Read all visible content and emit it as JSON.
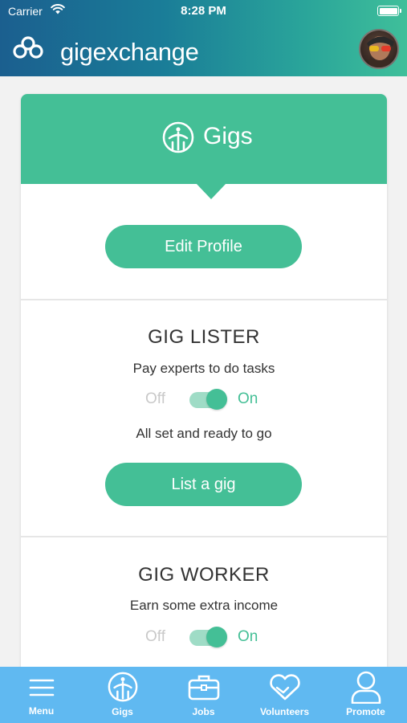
{
  "status_bar": {
    "carrier": "Carrier",
    "time": "8:28 PM"
  },
  "header": {
    "brand": "gigexchange",
    "logo_icon": "infinity-link-icon",
    "avatar_icon": "user-avatar"
  },
  "card": {
    "title": "Gigs",
    "title_icon": "gig-person-icon",
    "edit_profile_label": "Edit Profile",
    "lister": {
      "title": "GIG LISTER",
      "subtitle": "Pay experts to do tasks",
      "toggle_off_label": "Off",
      "toggle_on_label": "On",
      "toggle_state": "on",
      "status": "All set and ready to go",
      "action_label": "List a gig"
    },
    "worker": {
      "title": "GIG WORKER",
      "subtitle": "Earn some extra income",
      "toggle_off_label": "Off",
      "toggle_on_label": "On",
      "toggle_state": "on"
    }
  },
  "tabbar": {
    "items": [
      {
        "label": "Menu",
        "icon": "hamburger-icon"
      },
      {
        "label": "Gigs",
        "icon": "gig-person-icon"
      },
      {
        "label": "Jobs",
        "icon": "briefcase-icon"
      },
      {
        "label": "Volunteers",
        "icon": "heart-hands-icon"
      },
      {
        "label": "Promote",
        "icon": "person-icon"
      }
    ]
  },
  "colors": {
    "accent": "#44bf96",
    "tabbar": "#60b9f1",
    "header_start": "#1b5f8f",
    "header_end": "#3fbf9a"
  }
}
